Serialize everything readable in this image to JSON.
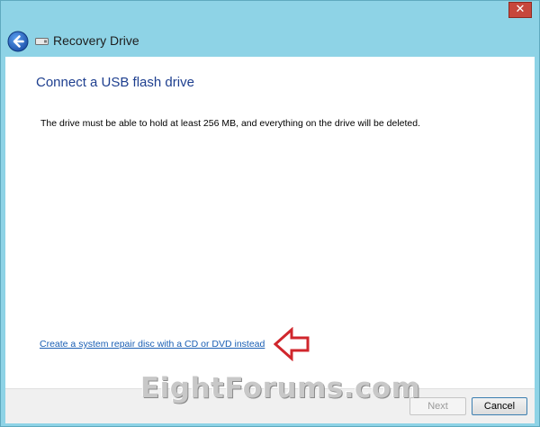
{
  "window": {
    "title": "Recovery Drive",
    "close_glyph": "✕",
    "accent_color": "#8ed3e6"
  },
  "nav": {
    "back_icon": "back-arrow-icon",
    "app_icon": "usb-drive-icon"
  },
  "content": {
    "heading": "Connect a USB flash drive",
    "description": "The drive must be able to hold at least 256 MB, and everything on the drive will be deleted.",
    "repair_link": "Create a system repair disc with a CD or DVD instead"
  },
  "footer": {
    "next_label": "Next",
    "cancel_label": "Cancel"
  },
  "watermark": {
    "text": "EightForums.com"
  },
  "annotation": {
    "arrow_icon": "red-arrow-icon",
    "arrow_color": "#d0262c"
  }
}
